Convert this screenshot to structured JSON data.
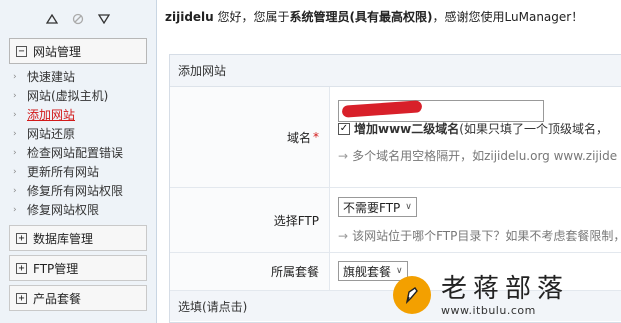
{
  "header": {
    "username": "zijidelu",
    "prefix": " 您好，您属于",
    "role": "系统管理员(具有最高权限)",
    "suffix": "，感谢您使用LuManager！"
  },
  "sidebar": {
    "groups": [
      {
        "label": "网站管理",
        "toggle": "−",
        "expanded": true,
        "items": [
          {
            "label": "快速建站",
            "active": false
          },
          {
            "label": "网站(虚拟主机)",
            "active": false
          },
          {
            "label": "添加网站",
            "active": true
          },
          {
            "label": "网站还原",
            "active": false
          },
          {
            "label": "检查网站配置错误",
            "active": false
          },
          {
            "label": "更新所有网站",
            "active": false
          },
          {
            "label": "修复所有网站权限",
            "active": false
          },
          {
            "label": "修复网站权限",
            "active": false
          }
        ]
      },
      {
        "label": "数据库管理",
        "toggle": "+",
        "expanded": false
      },
      {
        "label": "FTP管理",
        "toggle": "+",
        "expanded": false
      },
      {
        "label": "产品套餐",
        "toggle": "+",
        "expanded": false
      }
    ]
  },
  "form": {
    "title": "添加网站",
    "domain": {
      "label": "域名",
      "required_mark": "*",
      "value": "",
      "checkbox_checked": true,
      "checkbox_label": "增加www二级域名",
      "checkbox_note": " (如果只填了一个顶级域名，",
      "hint": "多个域名用空格隔开，如zijidelu.org www.zijide"
    },
    "ftp": {
      "label": "选择FTP",
      "selected": "不需要FTP",
      "hint": "该网站位于哪个FTP目录下？如果不考虑套餐限制，"
    },
    "package": {
      "label": "所属套餐",
      "selected": "旗舰套餐"
    },
    "optional_label": "选填(请点击)"
  },
  "watermark": {
    "brand": "老蒋部落",
    "url": "www.itbulu.com"
  },
  "colors": {
    "active_link": "#d21a1a",
    "required": "#d21a1a",
    "watermark_logo": "#f3a000",
    "sidebar_bg": "#eef3f8"
  }
}
